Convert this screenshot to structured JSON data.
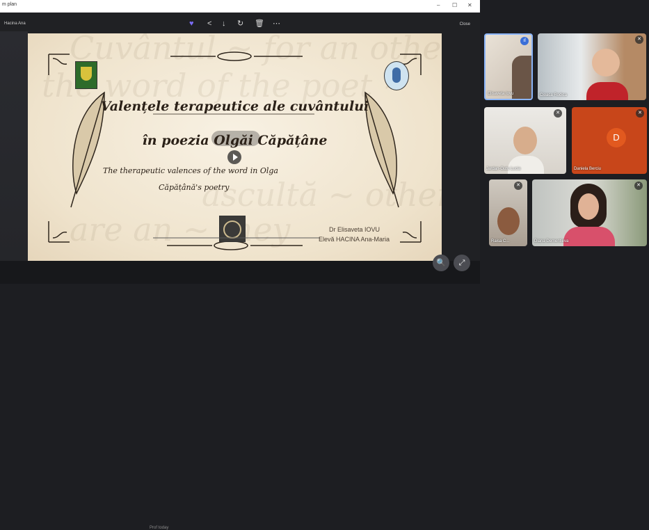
{
  "window": {
    "title": "m plan",
    "controls": [
      "–",
      "☐",
      "✕"
    ]
  },
  "toolbar": {
    "breadcrumb": "Hacina Ana",
    "close_label": "Close",
    "icons": [
      "heart-icon",
      "share-icon",
      "download-icon",
      "rotate-icon",
      "delete-icon",
      "more-icon"
    ]
  },
  "slide": {
    "title_line1": "Valențele terapeutice ale cuvântului",
    "title_line2": "în poezia Olgăi Căpățâne",
    "subtitle_line1": "The therapeutic valences of the word in Olga",
    "subtitle_line2": "Căpățână's poetry",
    "author1": "Dr Elisaveta IOVU",
    "author2": "Elevă HACINA Ana-Maria"
  },
  "viewer": {
    "caption": "Prof today"
  },
  "participants": [
    {
      "name": "Elisaveta Iovu",
      "speaking": true
    },
    {
      "name": "Cioaca Rodica"
    },
    {
      "name": "Jardan-Gutu Lucia"
    },
    {
      "name": "Daniela Berciu",
      "initial": "D"
    },
    {
      "name": "Raisa C..."
    },
    {
      "name": "Diana Dementieva"
    }
  ],
  "colors": {
    "background": "#1d1e22",
    "tile_orange": "#c8461a",
    "avatar_orange": "#e2591f",
    "active_speaker": "#8ab4f8"
  }
}
